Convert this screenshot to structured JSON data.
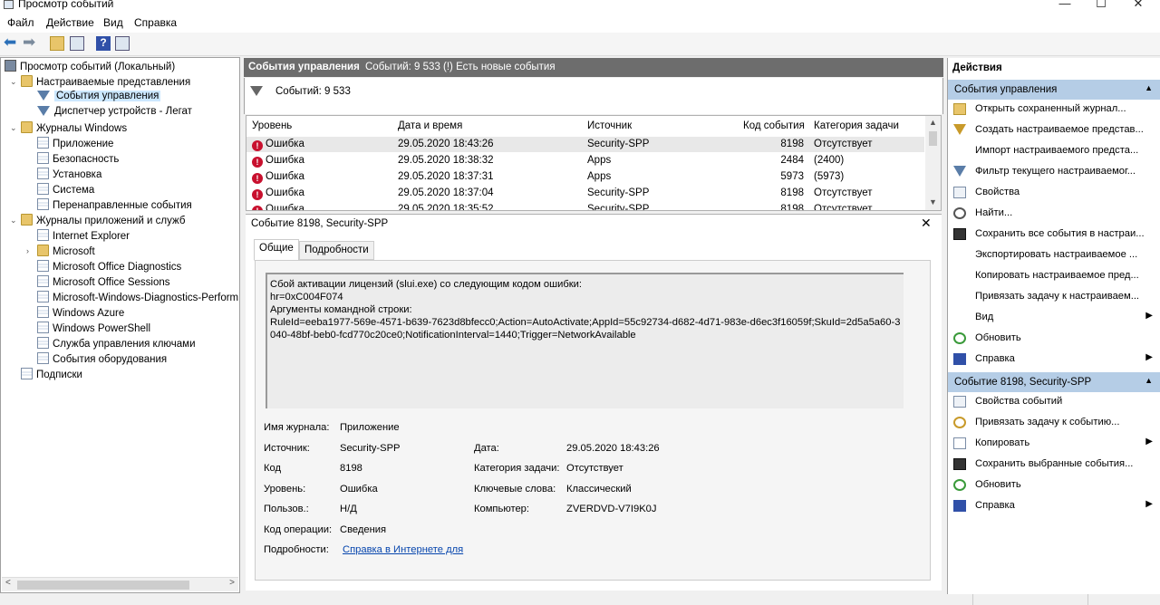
{
  "window": {
    "title": "Просмотр событий"
  },
  "menu": [
    "Файл",
    "Действие",
    "Вид",
    "Справка"
  ],
  "tree": [
    {
      "label": "Просмотр событий (Локальный)",
      "icon": "event-viewer-icon",
      "level": 0
    },
    {
      "label": "Настраиваемые представления",
      "icon": "folder-icon",
      "level": 1,
      "expander": "expanded"
    },
    {
      "label": "События управления",
      "icon": "filter-icon",
      "level": 2,
      "selected": true
    },
    {
      "label": "Диспетчер устройств - Легат",
      "icon": "filter-icon",
      "level": 2
    },
    {
      "label": "Журналы Windows",
      "icon": "folder-icon",
      "level": 1,
      "expander": "expanded"
    },
    {
      "label": "Приложение",
      "icon": "log-icon",
      "level": 2
    },
    {
      "label": "Безопасность",
      "icon": "log-icon",
      "level": 2
    },
    {
      "label": "Установка",
      "icon": "log-icon",
      "level": 2
    },
    {
      "label": "Система",
      "icon": "log-icon",
      "level": 2
    },
    {
      "label": "Перенаправленные события",
      "icon": "log-icon",
      "level": 2
    },
    {
      "label": "Журналы приложений и служб",
      "icon": "folder-icon",
      "level": 1,
      "expander": "expanded"
    },
    {
      "label": "Internet Explorer",
      "icon": "log-icon",
      "level": 2
    },
    {
      "label": "Microsoft",
      "icon": "folder-icon",
      "level": 2,
      "expander": "collapsed"
    },
    {
      "label": "Microsoft Office Diagnostics",
      "icon": "log-icon",
      "level": 2
    },
    {
      "label": "Microsoft Office Sessions",
      "icon": "log-icon",
      "level": 2
    },
    {
      "label": "Microsoft-Windows-Diagnostics-Perform",
      "icon": "log-icon",
      "level": 2
    },
    {
      "label": "Windows Azure",
      "icon": "log-icon",
      "level": 2
    },
    {
      "label": "Windows PowerShell",
      "icon": "log-icon",
      "level": 2
    },
    {
      "label": "Служба управления ключами",
      "icon": "log-icon",
      "level": 2
    },
    {
      "label": "События оборудования",
      "icon": "log-icon",
      "level": 2
    },
    {
      "label": "Подписки",
      "icon": "log-icon",
      "level": 1
    }
  ],
  "center": {
    "title": "События управления",
    "summary": "Событий: 9 533 (!) Есть новые события",
    "filter_text": "Событий: 9 533"
  },
  "grid": {
    "columns": [
      "Уровень",
      "Дата и время",
      "Источник",
      "Код события",
      "Категория задачи"
    ],
    "rows": [
      {
        "level": "Ошибка",
        "date": "29.05.2020 18:43:26",
        "source": "Security-SPP",
        "code": "8198",
        "category": "Отсутствует"
      },
      {
        "level": "Ошибка",
        "date": "29.05.2020 18:38:32",
        "source": "Apps",
        "code": "2484",
        "category": "(2400)"
      },
      {
        "level": "Ошибка",
        "date": "29.05.2020 18:37:31",
        "source": "Apps",
        "code": "5973",
        "category": "(5973)"
      },
      {
        "level": "Ошибка",
        "date": "29.05.2020 18:37:04",
        "source": "Security-SPP",
        "code": "8198",
        "category": "Отсутствует"
      },
      {
        "level": "Ошибка",
        "date": "29.05.2020 18:35:52",
        "source": "Security-SPP",
        "code": "8198",
        "category": "Отсутствует"
      }
    ]
  },
  "detail": {
    "title": "Событие 8198, Security-SPP",
    "tabs": [
      "Общие",
      "Подробности"
    ],
    "message": "Сбой активации лицензий (slui.exe) со следующим кодом ошибки:\nhr=0xC004F074\nАргументы командной строки:\nRuleId=eeba1977-569e-4571-b639-7623d8bfecc0;Action=AutoActivate;AppId=55c92734-d682-4d71-983e-d6ec3f16059f;SkuId=2d5a5a60-3040-48bf-beb0-fcd770c20ce0;NotificationInterval=1440;Trigger=NetworkAvailable",
    "fields": {
      "log_name_label": "Имя журнала:",
      "log_name": "Приложение",
      "source_label": "Источник:",
      "source": "Security-SPP",
      "date_label": "Дата:",
      "date": "29.05.2020 18:43:26",
      "code_label": "Код",
      "code": "8198",
      "category_label": "Категория задачи:",
      "category": "Отсутствует",
      "level_label": "Уровень:",
      "level": "Ошибка",
      "keywords_label": "Ключевые слова:",
      "keywords": "Классический",
      "user_label": "Пользов.:",
      "user": "Н/Д",
      "computer_label": "Компьютер:",
      "computer": "ZVERDVD-V7I9K0J",
      "opcode_label": "Код операции:",
      "opcode": "Сведения",
      "more_label": "Подробности:",
      "more_link": "Справка в Интернете для"
    }
  },
  "actions": {
    "header": "Действия",
    "section1": "События управления",
    "items1": [
      {
        "label": "Открыть сохраненный журнал...",
        "icon": "open-folder-icon"
      },
      {
        "label": "Создать настраиваемое представ...",
        "icon": "filter-create-icon"
      },
      {
        "label": "Импорт настраиваемого предста...",
        "icon": ""
      },
      {
        "label": "Фильтр текущего настраиваемог...",
        "icon": "filter-icon"
      },
      {
        "label": "Свойства",
        "icon": "properties-icon"
      },
      {
        "label": "Найти...",
        "icon": "find-icon"
      },
      {
        "label": "Сохранить все события в настраи...",
        "icon": "save-icon"
      },
      {
        "label": "Экспортировать настраиваемое ...",
        "icon": ""
      },
      {
        "label": "Копировать настраиваемое пред...",
        "icon": ""
      },
      {
        "label": "Привязать задачу к настраиваем...",
        "icon": ""
      },
      {
        "label": "Вид",
        "icon": "",
        "submenu": true
      },
      {
        "label": "Обновить",
        "icon": "refresh-icon"
      },
      {
        "label": "Справка",
        "icon": "help-icon",
        "submenu": true
      }
    ],
    "section2": "Событие 8198, Security-SPP",
    "items2": [
      {
        "label": "Свойства событий",
        "icon": "properties-icon"
      },
      {
        "label": "Привязать задачу к событию...",
        "icon": "task-icon"
      },
      {
        "label": "Копировать",
        "icon": "copy-icon",
        "submenu": true
      },
      {
        "label": "Сохранить выбранные события...",
        "icon": "save-icon"
      },
      {
        "label": "Обновить",
        "icon": "refresh-icon"
      },
      {
        "label": "Справка",
        "icon": "help-icon",
        "submenu": true
      }
    ]
  }
}
